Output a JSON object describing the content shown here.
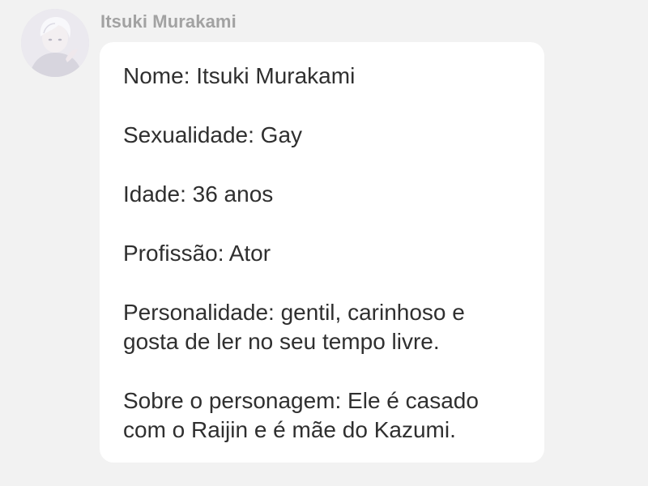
{
  "message": {
    "author": "Itsuki Murakami",
    "avatar_icon": "user-avatar-icon",
    "lines": [
      "Nome: Itsuki Murakami",
      "Sexualidade: Gay",
      "Idade: 36 anos",
      "Profissão: Ator",
      "Personalidade: gentil, carinhoso e",
      "gosta de ler no seu tempo livre.",
      "Sobre o personagem: Ele é casado",
      "com o Raijin e é mãe do Kazumi."
    ]
  },
  "colors": {
    "background": "#f2f2f2",
    "bubble": "#ffffff",
    "username": "#a2a2a2",
    "text": "#2f2f2f"
  }
}
